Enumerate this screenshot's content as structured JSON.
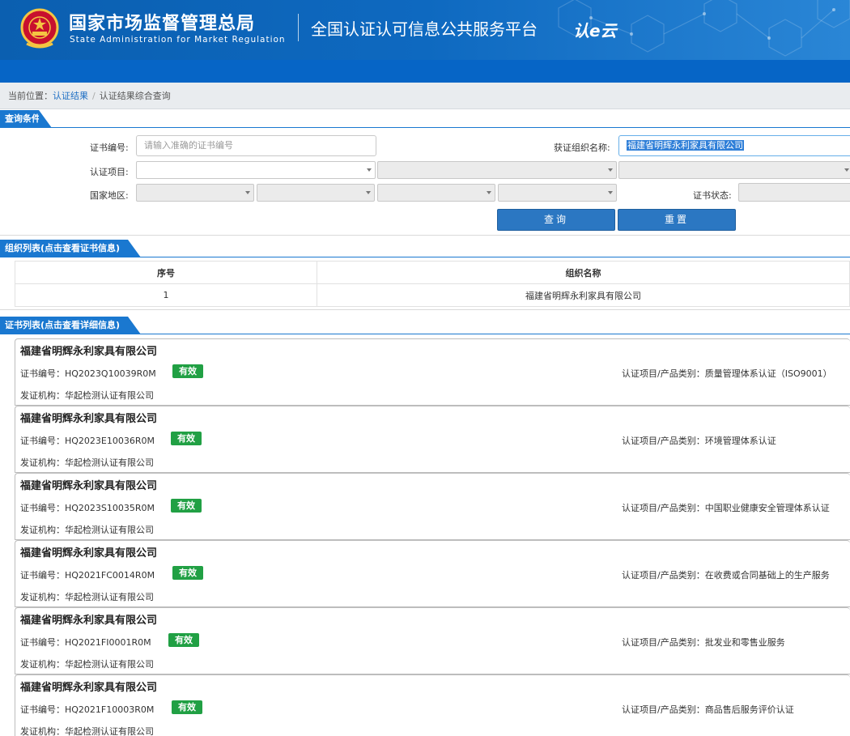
{
  "header": {
    "agency_cn": "国家市场监督管理总局",
    "agency_en": "State Administration  for  Market Regulation",
    "platform": "全国认证认可信息公共服务平台",
    "logo_text": "认e云"
  },
  "breadcrumb": {
    "prefix": "当前位置：",
    "item1": "认证结果",
    "separator": "/",
    "item2": "认证结果综合查询"
  },
  "query": {
    "section_title": "查询条件",
    "cert_no_label": "证书编号:",
    "cert_no_placeholder": "请输入准确的证书编号",
    "org_name_label": "获证组织名称:",
    "org_name_value": "福建省明辉永利家具有限公司",
    "cert_item_label": "认证项目:",
    "region_label": "国家地区:",
    "status_label": "证书状态:",
    "search_button": "查询",
    "reset_button": "重置"
  },
  "org_list": {
    "section_title": "组织列表(点击查看证书信息)",
    "columns": [
      "序号",
      "组织名称"
    ],
    "rows": [
      {
        "index": "1",
        "name": "福建省明辉永利家具有限公司"
      }
    ]
  },
  "cert_list": {
    "section_title": "证书列表(点击查看详细信息)",
    "cert_no_prefix": "证书编号：",
    "category_prefix": "认证项目/产品类别：",
    "issuer_prefix": "发证机构：",
    "items": [
      {
        "org": "福建省明辉永利家具有限公司",
        "cert_no": "HQ2023Q10039R0M",
        "status": "有效",
        "category": "质量管理体系认证（ISO9001）",
        "issuer": "华起检测认证有限公司"
      },
      {
        "org": "福建省明辉永利家具有限公司",
        "cert_no": "HQ2023E10036R0M",
        "status": "有效",
        "category": "环境管理体系认证",
        "issuer": "华起检测认证有限公司"
      },
      {
        "org": "福建省明辉永利家具有限公司",
        "cert_no": "HQ2023S10035R0M",
        "status": "有效",
        "category": "中国职业健康安全管理体系认证",
        "issuer": "华起检测认证有限公司"
      },
      {
        "org": "福建省明辉永利家具有限公司",
        "cert_no": "HQ2021FC0014R0M",
        "status": "有效",
        "category": "在收费或合同基础上的生产服务",
        "issuer": "华起检测认证有限公司"
      },
      {
        "org": "福建省明辉永利家具有限公司",
        "cert_no": "HQ2021FI0001R0M",
        "status": "有效",
        "category": "批发业和零售业服务",
        "issuer": "华起检测认证有限公司"
      },
      {
        "org": "福建省明辉永利家具有限公司",
        "cert_no": "HQ2021F10003R0M",
        "status": "有效",
        "category": "商品售后服务评价认证",
        "issuer": "华起检测认证有限公司"
      }
    ]
  },
  "colors": {
    "header_blue": "#0b5fb0",
    "section_blue": "#1a78d0",
    "button_blue": "#2b77c2",
    "valid_green": "#21a044"
  }
}
